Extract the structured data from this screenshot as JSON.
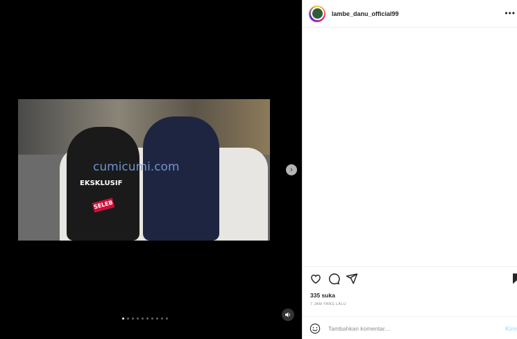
{
  "media": {
    "watermark": "cumicumi.com",
    "overlay_label": "EKSKLUSIF",
    "mic_label": "SELEB",
    "next_icon": "chevron-right-icon",
    "audio_icon": "speaker-icon",
    "carousel": {
      "count": 10,
      "active_index": 0
    }
  },
  "post": {
    "username": "lambe_danu_official99",
    "more_icon": "more-horizontal-icon",
    "likes_text": "335 suka",
    "time_text": "7 JAM YANG LALU",
    "comment": {
      "placeholder": "Tambahkan komentar...",
      "value": ""
    },
    "post_button_label": "Kirim"
  },
  "colors": {
    "accent_disabled": "#b2dffc",
    "muted_text": "#8e8e8e"
  }
}
